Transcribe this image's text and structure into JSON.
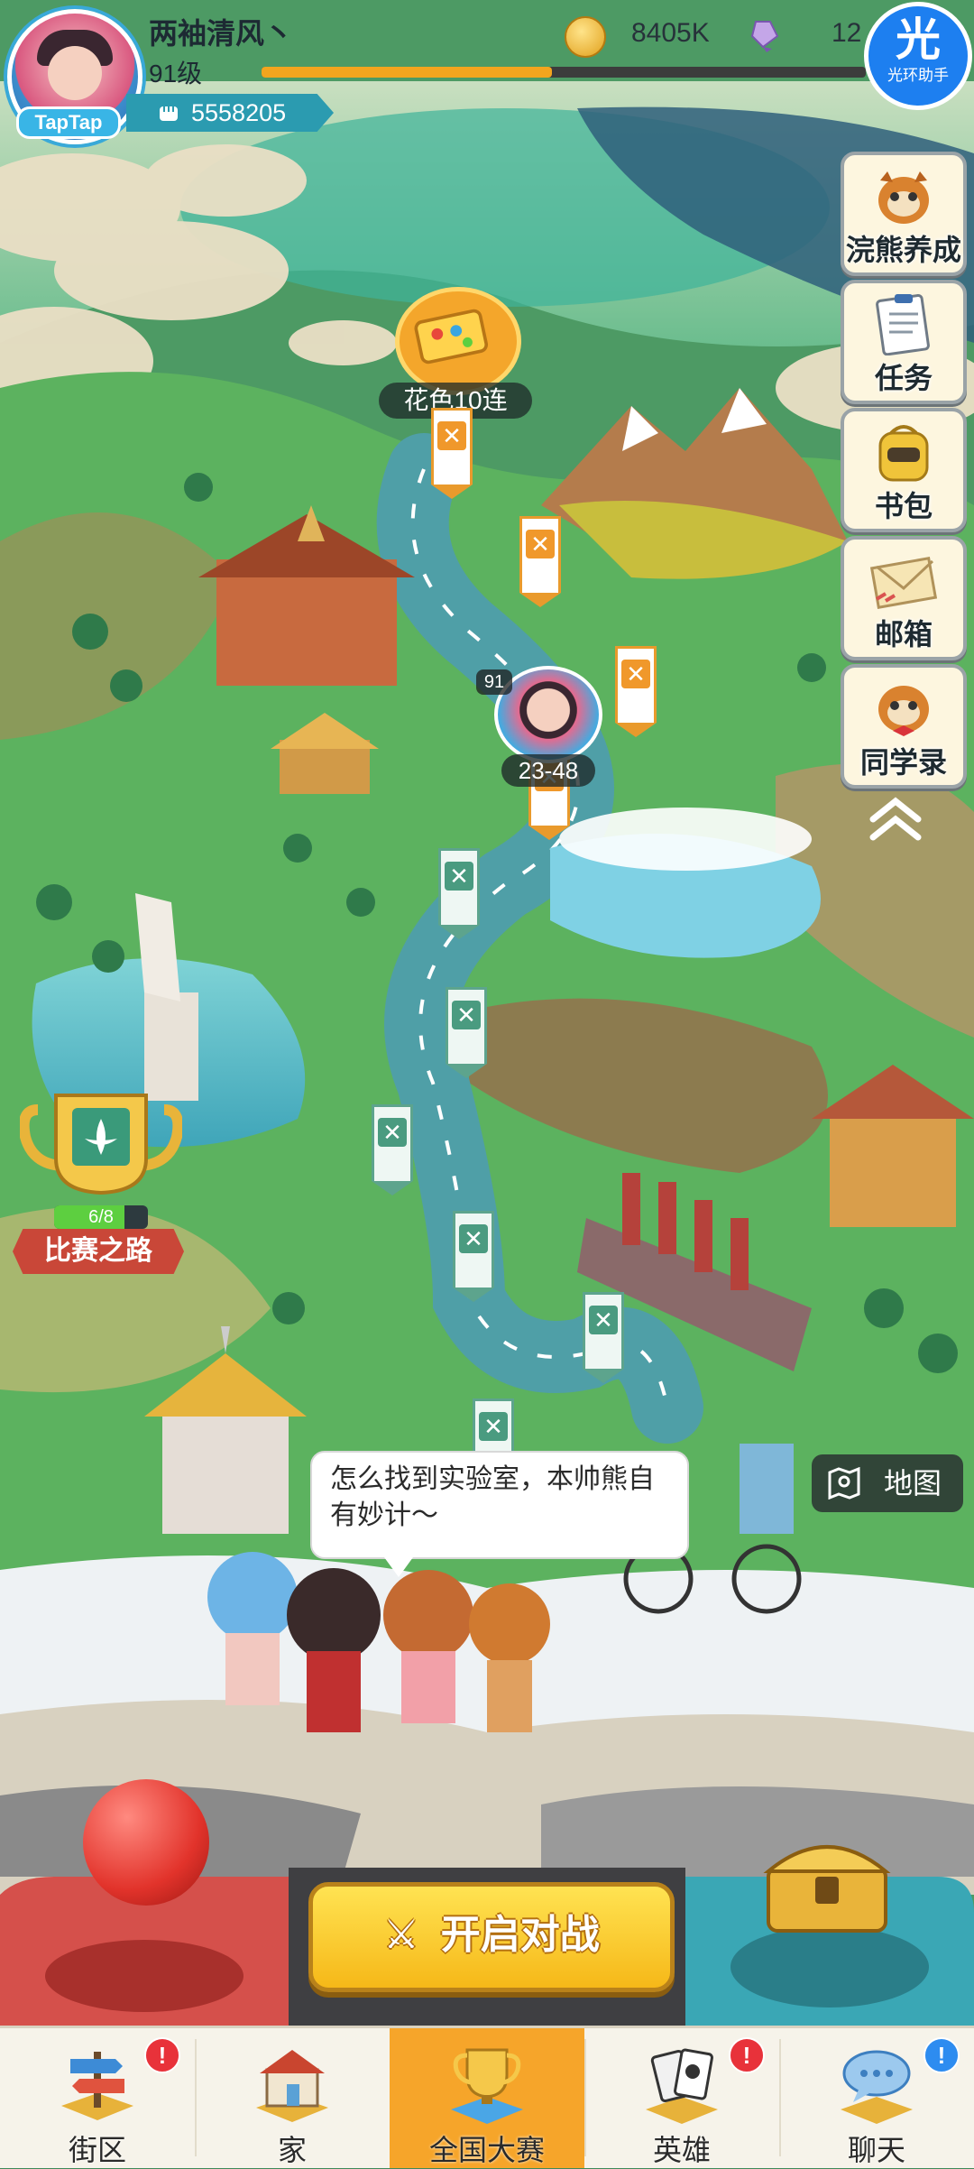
{
  "player": {
    "name": "两袖清风丶",
    "level": "91级",
    "power": "5558205",
    "avatar_brand": "TapTap",
    "xp_fraction": 0.48
  },
  "currency": {
    "coins": "8405K",
    "gems": "12"
  },
  "helper": {
    "glyph": "光",
    "label": "光环助手"
  },
  "side_menu": [
    {
      "label": "浣熊养成",
      "icon": "raccoon-icon"
    },
    {
      "label": "任务",
      "icon": "clipboard-icon"
    },
    {
      "label": "书包",
      "icon": "backpack-icon"
    },
    {
      "label": "邮箱",
      "icon": "envelope-icon"
    },
    {
      "label": "同学录",
      "icon": "raccoon-bowtie-icon"
    }
  ],
  "map": {
    "event_label": "花色10连",
    "marker_level": "91",
    "marker_stage": "23-48",
    "trophy_progress": "6/8",
    "trophy_fraction": 0.75,
    "road_label": "比赛之路",
    "map_button": "地图"
  },
  "dialog": {
    "text": "怎么找到实验室，本帅熊自有妙计～"
  },
  "controls": {
    "start_battle": "开启对战"
  },
  "nav": [
    {
      "label": "街区",
      "badge": "!",
      "badge_color": "red",
      "icon": "signpost-icon"
    },
    {
      "label": "家",
      "badge": "",
      "badge_color": "",
      "icon": "house-icon"
    },
    {
      "label": "全国大赛",
      "badge": "",
      "badge_color": "",
      "icon": "trophy-icon",
      "active": true
    },
    {
      "label": "英雄",
      "badge": "!",
      "badge_color": "red",
      "icon": "cards-icon"
    },
    {
      "label": "聊天",
      "badge": "!",
      "badge_color": "blue",
      "icon": "chat-icon"
    }
  ],
  "colors": {
    "accent": "#f6a52a",
    "power_badge": "#2b9bb0",
    "road_banner": "#c94738"
  }
}
